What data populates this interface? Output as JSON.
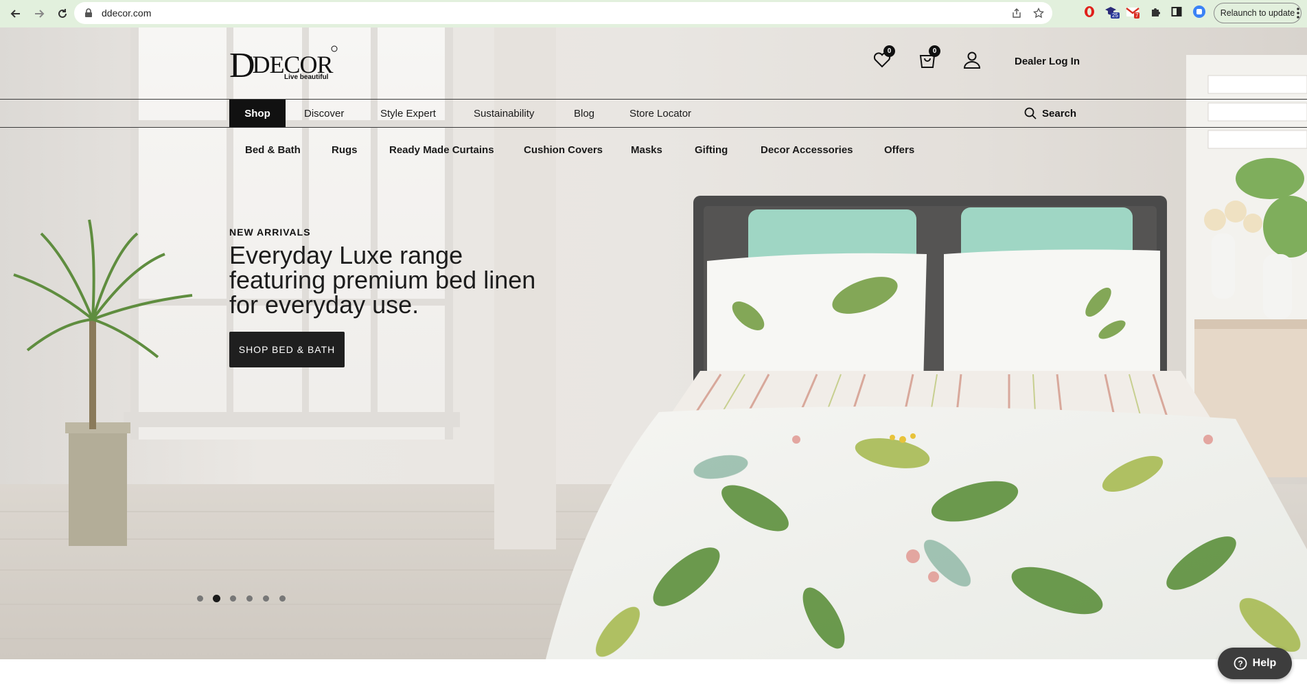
{
  "browser": {
    "url": "ddecor.com",
    "relaunch_label": "Relaunch to update",
    "extension_badges": [
      "25",
      "7"
    ]
  },
  "header": {
    "logo_text": "D'DECOR",
    "logo_tagline": "Live beautiful",
    "wishlist_count": "0",
    "cart_count": "0",
    "dealer_login": "Dealer Log In"
  },
  "nav": {
    "items": [
      "Shop",
      "Discover",
      "Style Expert",
      "Sustainability",
      "Blog",
      "Store Locator"
    ],
    "active": "Shop",
    "search_label": "Search"
  },
  "subnav": {
    "items": [
      "Bed & Bath",
      "Rugs",
      "Ready Made Curtains",
      "Cushion Covers",
      "Masks",
      "Gifting",
      "Decor Accessories",
      "Offers"
    ]
  },
  "hero": {
    "kicker": "NEW ARRIVALS",
    "headline": "Everyday Luxe range featuring premium bed linen for everyday use.",
    "cta_label": "SHOP BED & BATH",
    "slide_count": 6,
    "active_slide": 2
  },
  "help": {
    "label": "Help"
  },
  "colors": {
    "dark": "#111111",
    "chrome_bg": "#e2f0dd",
    "mint_pillow": "#9fd6c4"
  }
}
